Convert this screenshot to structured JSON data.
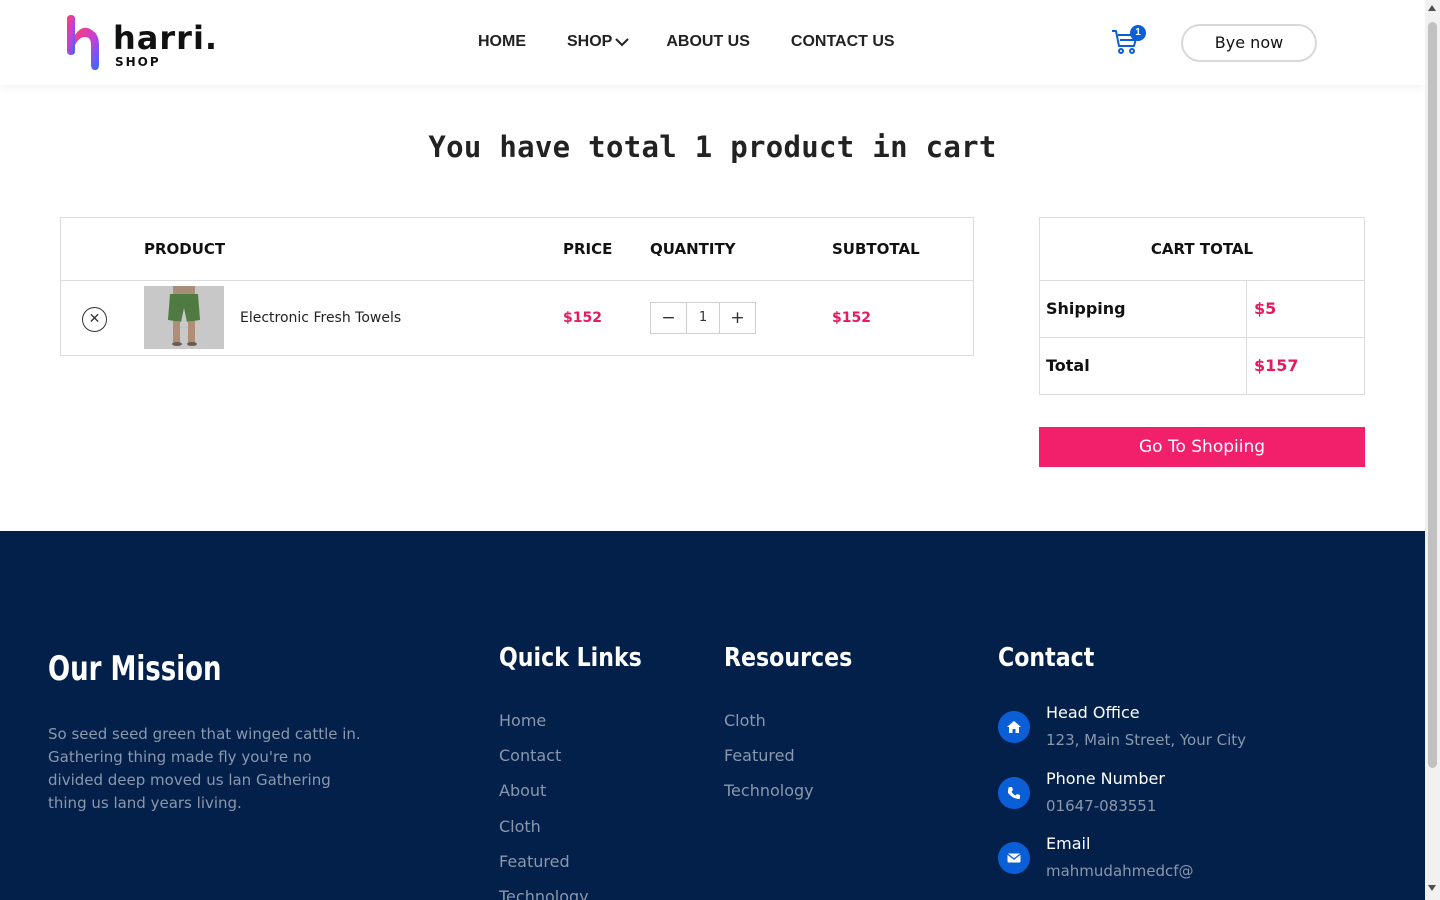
{
  "header": {
    "logo_name": "harri.",
    "logo_sub": "SHOP",
    "nav": [
      "HOME",
      "SHOP",
      "ABOUT US",
      "CONTACT US"
    ],
    "cart_count": "1",
    "buy_label": "Bye now",
    "accent_color": "#0a5fd6"
  },
  "cart": {
    "title": "You have total 1 product in cart",
    "columns": [
      "PRODUCT",
      "PRICE",
      "QUANTITY",
      "SUBTOTAL"
    ],
    "items": [
      {
        "remove_icon": "close-icon",
        "name": "Electronic Fresh Towels",
        "price": "$152",
        "quantity": "1",
        "subtotal": "$152"
      }
    ],
    "price_color": "#e8195e"
  },
  "totals": {
    "title": "CART TOTAL",
    "shipping_label": "Shipping",
    "shipping_value": "$5",
    "total_label": "Total",
    "total_value": "$157",
    "button_label": "Go To Shopiing",
    "button_color": "#f21f6a"
  },
  "footer": {
    "background": "#03204a",
    "mission_title": "Our Mission",
    "mission_text": "So seed seed green that winged cattle in. Gathering thing made fly you're no divided deep moved us lan Gathering thing us land years living.",
    "quick_links_title": "Quick Links",
    "quick_links": [
      "Home",
      "Contact",
      "About",
      "Cloth",
      "Featured",
      "Technology"
    ],
    "resources_title": "Resources",
    "resources": [
      "Cloth",
      "Featured",
      "Technology"
    ],
    "contact_title": "Contact",
    "contact": [
      {
        "icon": "home-icon",
        "label": "Head Office",
        "value": "123, Main Street, Your City"
      },
      {
        "icon": "phone-icon",
        "label": "Phone Number",
        "value": "01647-083551"
      },
      {
        "icon": "mail-icon",
        "label": "Email",
        "value": "mahmudahmedcf@"
      }
    ]
  }
}
